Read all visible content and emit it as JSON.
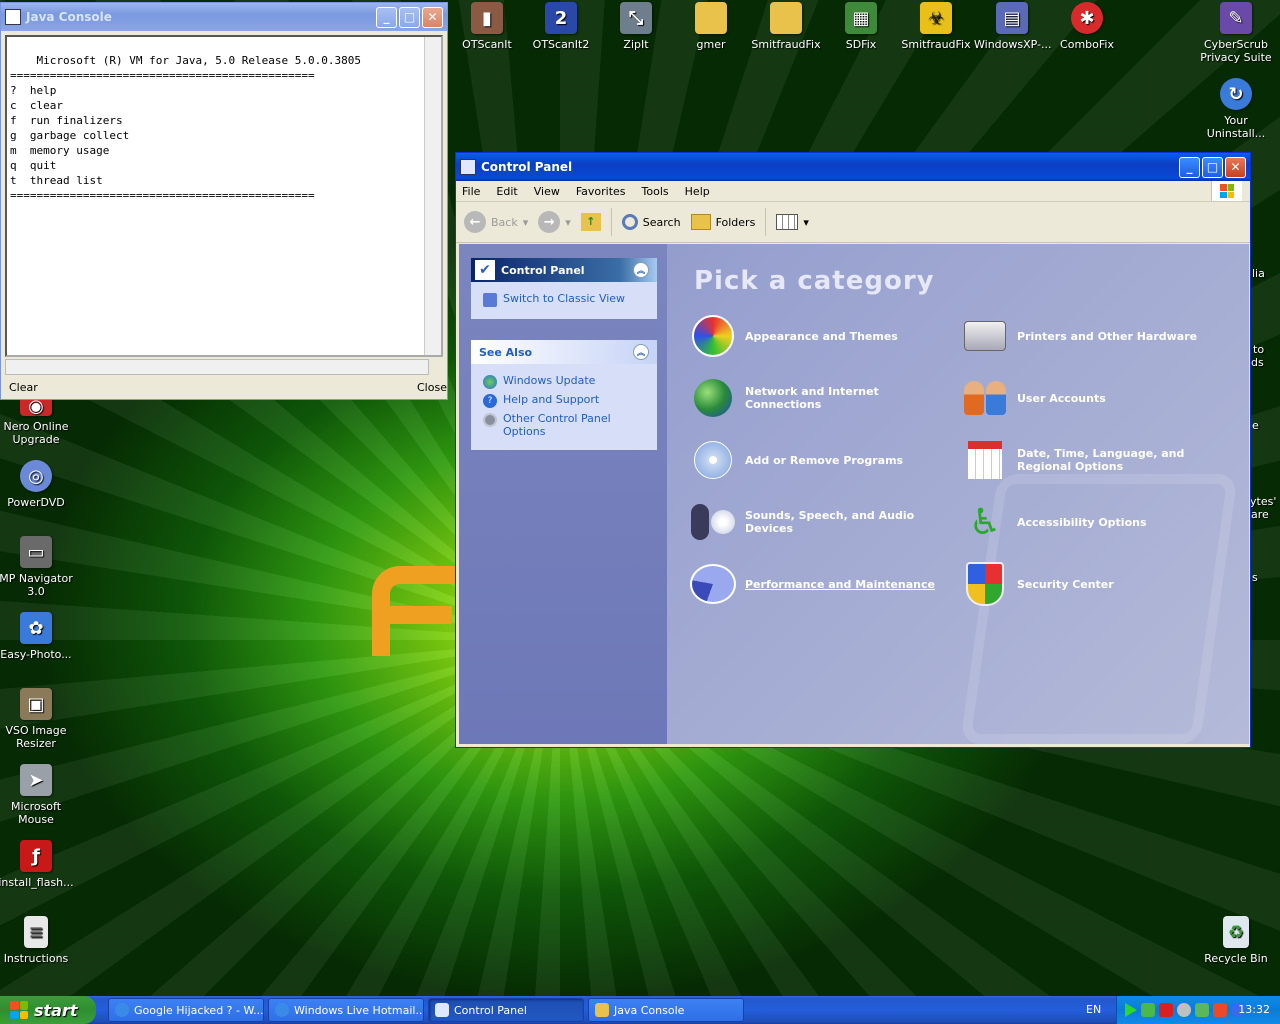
{
  "desktop": {
    "icons_top": [
      {
        "label": "OTScanIt",
        "color": "#8a5a44"
      },
      {
        "label": "OTScanIt2",
        "color": "#2a48a8"
      },
      {
        "label": "ZipIt",
        "color": "#6e7e8c"
      },
      {
        "label": "gmer",
        "color": "#e8c24a"
      },
      {
        "label": "SmitfraudFix",
        "color": "#e8c24a"
      },
      {
        "label": "SDFix",
        "color": "#3e8a3a"
      },
      {
        "label": "SmitfraudFix",
        "color": "#e8c018"
      },
      {
        "label": "WindowsXP-...",
        "color": "#5a6ab8"
      },
      {
        "label": "ComboFix",
        "color": "#d82a2a"
      },
      {
        "label": "CyberScrub Privacy Suite",
        "color": "#6a4aa8"
      }
    ],
    "icon_your_uninstall": "Your Uninstall...",
    "icons_left": [
      {
        "label": "Nero Online Upgrade",
        "color": "#c82828"
      },
      {
        "label": "PowerDVD",
        "color": "#6a8ad8"
      },
      {
        "label": "MP Navigator 3.0",
        "color": "#6a6a6a"
      },
      {
        "label": "Easy-Photo...",
        "color": "#3a7ad8"
      },
      {
        "label": "VSO Image Resizer",
        "color": "#8a7a5a"
      },
      {
        "label": "Microsoft Mouse",
        "color": "#9aa0a8"
      },
      {
        "label": "install_flash...",
        "color": "#c81818"
      },
      {
        "label": "Instructions",
        "color": "#e8e8e8"
      }
    ],
    "recycle_bin": "Recycle Bin",
    "partial_right_labels": [
      "lia",
      "to",
      "ds",
      "e",
      "ytes'",
      "are",
      "s"
    ]
  },
  "java_console": {
    "title": "Java Console",
    "text": "Microsoft (R) VM for Java, 5.0 Release 5.0.0.3805\n==============================================\n?  help\nc  clear\nf  run finalizers\ng  garbage collect\nm  memory usage\nq  quit\nt  thread list\n==============================================",
    "clear_button": "Clear",
    "close_button": "Close"
  },
  "control_panel": {
    "title": "Control Panel",
    "menu": [
      "File",
      "Edit",
      "View",
      "Favorites",
      "Tools",
      "Help"
    ],
    "toolbar": {
      "back": "Back",
      "search": "Search",
      "folders": "Folders"
    },
    "side_panel": {
      "title": "Control Panel",
      "switch_link": "Switch to Classic View",
      "see_also_title": "See Also",
      "see_also": [
        "Windows Update",
        "Help and Support",
        "Other Control Panel Options"
      ]
    },
    "heading": "Pick a category",
    "categories": [
      {
        "label": "Appearance and Themes",
        "icon": "appearance-icon"
      },
      {
        "label": "Printers and Other Hardware",
        "icon": "printer-icon"
      },
      {
        "label": "Network and Internet Connections",
        "icon": "network-icon"
      },
      {
        "label": "User Accounts",
        "icon": "users-icon"
      },
      {
        "label": "Add or Remove Programs",
        "icon": "add-remove-icon"
      },
      {
        "label": "Date, Time, Language, and Regional Options",
        "icon": "date-time-icon"
      },
      {
        "label": "Sounds, Speech, and Audio Devices",
        "icon": "sound-icon"
      },
      {
        "label": "Accessibility Options",
        "icon": "accessibility-icon"
      },
      {
        "label": "Performance and Maintenance",
        "icon": "performance-icon"
      },
      {
        "label": "Security Center",
        "icon": "shield-icon"
      }
    ]
  },
  "taskbar": {
    "start": "start",
    "buttons": [
      {
        "label": "Google Hijacked ? - W..."
      },
      {
        "label": "Windows Live Hotmail..."
      },
      {
        "label": "Control Panel"
      },
      {
        "label": "Java Console"
      }
    ],
    "language": "EN",
    "clock": "13:32"
  }
}
